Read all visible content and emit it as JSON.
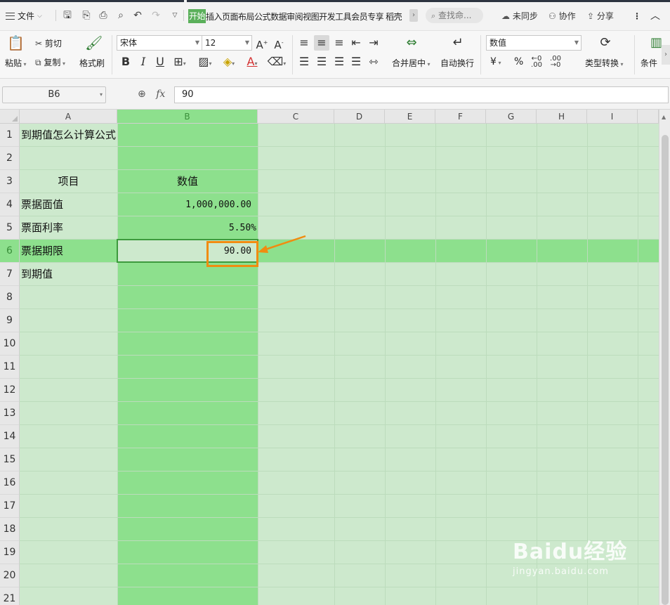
{
  "menubar": {
    "file_label": "文件",
    "tabs": [
      "开始",
      "插入",
      "页面布局",
      "公式",
      "数据",
      "审阅",
      "视图",
      "开发工具",
      "会员专享",
      "稻壳"
    ],
    "search_placeholder": "查找命...",
    "sync_label": "未同步",
    "collab_label": "协作",
    "share_label": "分享"
  },
  "ribbon": {
    "paste_label": "粘贴",
    "cut_label": "剪切",
    "copy_label": "复制",
    "format_painter_label": "格式刷",
    "font_name": "宋体",
    "font_size": "12",
    "merge_label": "合并居中",
    "wrap_label": "自动换行",
    "number_format": "数值",
    "currency_symbol": "¥",
    "percent_symbol": "%",
    "type_convert_label": "类型转换",
    "conditional_label": "条件"
  },
  "formula_bar": {
    "name_box": "B6",
    "fx_label": "fx",
    "value": "90"
  },
  "columns": [
    "A",
    "B",
    "C",
    "D",
    "E",
    "F",
    "G",
    "H",
    "I"
  ],
  "rows": [
    "1",
    "2",
    "3",
    "4",
    "5",
    "6",
    "7",
    "8",
    "9",
    "10",
    "11",
    "12",
    "13",
    "14",
    "15",
    "16",
    "17",
    "18",
    "19",
    "20",
    "21"
  ],
  "cells": {
    "A1": "到期值怎么计算公式",
    "A3": "项目",
    "B3": "数值",
    "A4": "票据面值",
    "B4": "1,000,000.00",
    "A5": "票面利率",
    "B5": "5.50%",
    "A6": "票据期限",
    "B6": "90.00",
    "A7": "到期值"
  },
  "watermark": {
    "logo": "Baidu经验",
    "url": "jingyan.baidu.com"
  },
  "colors": {
    "selection_green": "#8de08d",
    "sheet_green": "#cde9cd",
    "accent_orange": "#f08c10",
    "tab_active": "#5bb05b"
  }
}
